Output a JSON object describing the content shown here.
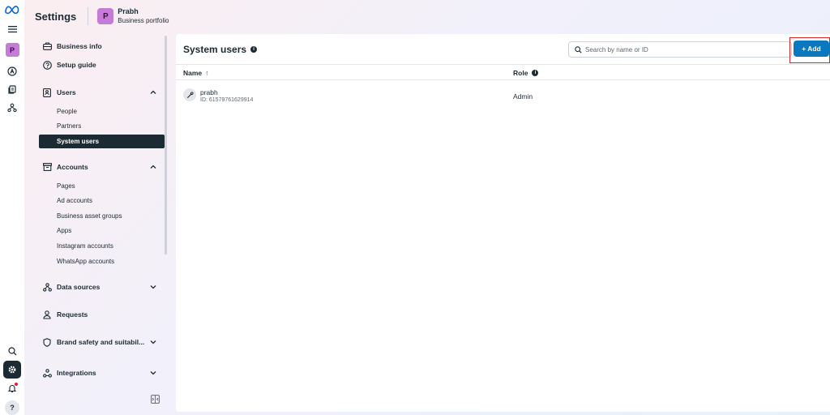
{
  "header": {
    "title": "Settings",
    "portfolio_initial": "P",
    "portfolio_name": "Prabh",
    "portfolio_subtitle": "Business portfolio"
  },
  "rail": {
    "items": [
      "meta-logo-icon",
      "menu-icon",
      "portfolio-avatar",
      "ads-icon",
      "pages-icon",
      "people-network-icon",
      "search-icon",
      "settings-icon",
      "notifications-icon",
      "help-icon"
    ],
    "avatar_initial": "P",
    "help_label": "?"
  },
  "sidebar": {
    "business_info": "Business info",
    "setup_guide": "Setup guide",
    "users": {
      "label": "Users",
      "items": [
        "People",
        "Partners",
        "System users"
      ],
      "active": "System users"
    },
    "accounts": {
      "label": "Accounts",
      "items": [
        "Pages",
        "Ad accounts",
        "Business asset groups",
        "Apps",
        "Instagram accounts",
        "WhatsApp accounts"
      ]
    },
    "data_sources": "Data sources",
    "requests": "Requests",
    "brand_safety": "Brand safety and suitabil...",
    "integrations": "Integrations"
  },
  "main": {
    "title": "System users",
    "search_placeholder": "Search by name or ID",
    "add_label": "+ Add",
    "columns": {
      "name": "Name",
      "name_sort": "↑",
      "role": "Role"
    },
    "rows": [
      {
        "name": "prabh",
        "id": "ID: 61579761629914",
        "role": "Admin"
      }
    ]
  },
  "colors": {
    "accent": "#0a78be",
    "active_nav": "#1c2b33",
    "avatar": "#c67bd8",
    "highlight": "#e0242b"
  }
}
